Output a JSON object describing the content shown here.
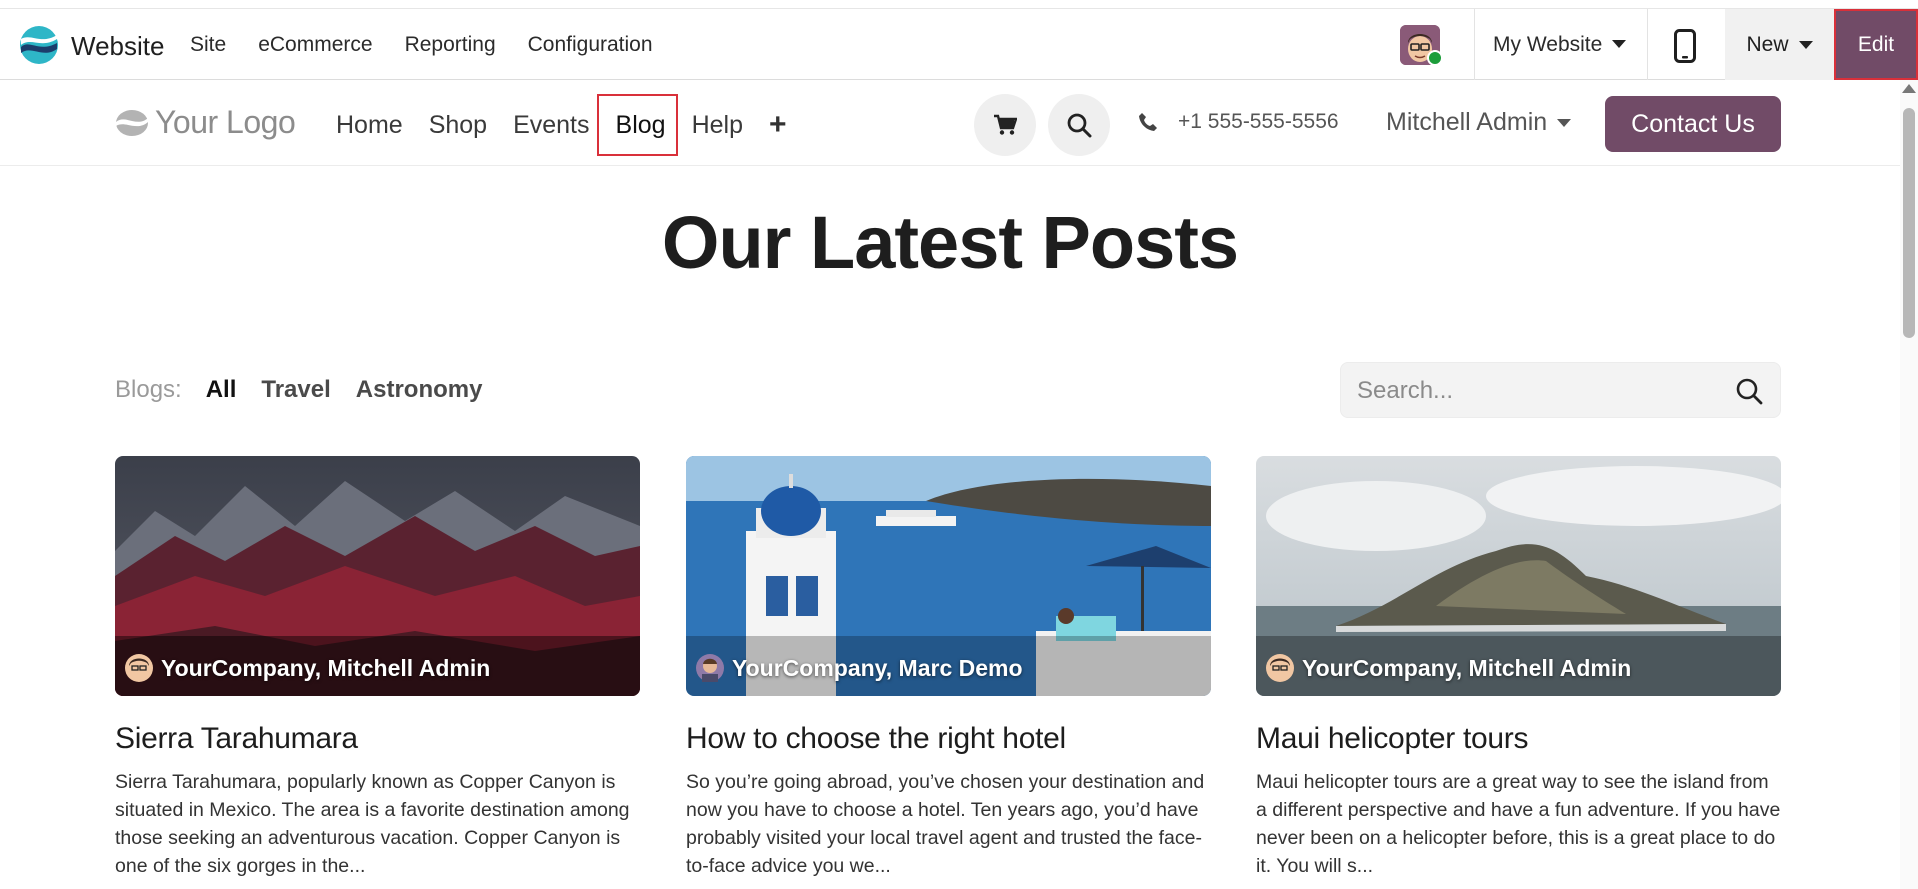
{
  "admin_bar": {
    "app_name": "Website",
    "menu": [
      "Site",
      "eCommerce",
      "Reporting",
      "Configuration"
    ],
    "website_selector": "My Website",
    "new_label": "New",
    "edit_label": "Edit"
  },
  "site_header": {
    "logo_text": "Your Logo",
    "nav": [
      "Home",
      "Shop",
      "Events",
      "Blog",
      "Help"
    ],
    "add_label": "+",
    "phone": "+1 555-555-5556",
    "user": "Mitchell Admin",
    "contact_label": "Contact Us"
  },
  "page": {
    "title": "Our Latest Posts",
    "blogs_label": "Blogs:",
    "blog_filters": [
      "All",
      "Travel",
      "Astronomy"
    ],
    "active_filter": "All",
    "search_placeholder": "Search..."
  },
  "posts": [
    {
      "author": "YourCompany, Mitchell Admin",
      "title": "Sierra Tarahumara",
      "excerpt": "Sierra Tarahumara, popularly known as Copper Canyon is situated in Mexico. The area is a favorite destination among those seeking an adventurous vacation. Copper Canyon is one of the six gorges in the..."
    },
    {
      "author": "YourCompany, Marc Demo",
      "title": "How to choose the right hotel",
      "excerpt": "So you’re going abroad, you’ve chosen your destination and now you have to choose a hotel. Ten years ago, you’d have probably visited your local travel agent and trusted the face-to-face advice you we..."
    },
    {
      "author": "YourCompany, Mitchell Admin",
      "title": "Maui helicopter tours",
      "excerpt": "Maui helicopter tours are a great way to see the island from a different perspective and have a fun adventure. If you have never been on a helicopter before, this is a great place to do it. You will s..."
    }
  ],
  "colors": {
    "brand": "#714b67",
    "highlight": "#d9303a",
    "status_online": "#1c9d3a"
  }
}
